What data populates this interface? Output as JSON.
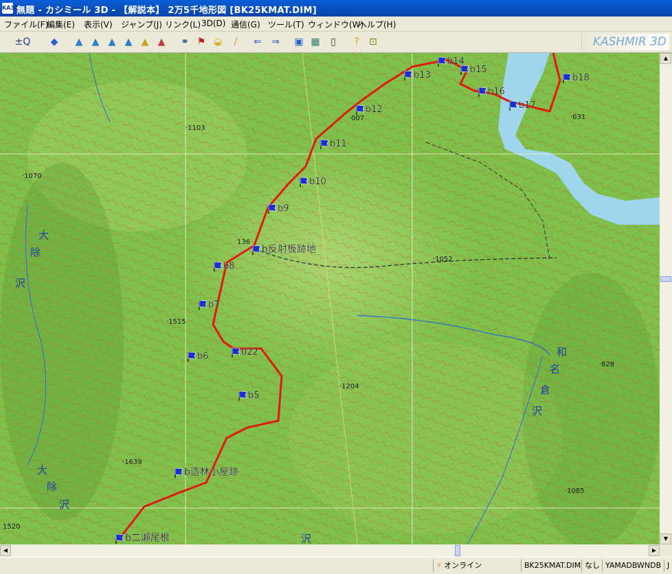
{
  "window": {
    "title": "無題 - カシミール 3D - 【解説本】 2万5千地形図 [BK25KMAT.DIM]",
    "app_icon_text": "KA3D"
  },
  "menu": [
    "ファイル(F)",
    "編集(E)",
    "表示(V)",
    "ジャンプ(J)",
    "リンク(L)",
    "3D(D)",
    "通信(G)",
    "ツール(T)",
    "ウィンドウ(W)",
    "ヘルプ(H)"
  ],
  "toolbar": {
    "brand": "KASHMIR 3D",
    "buttons": [
      {
        "name": "zoom-in-out",
        "glyph": "±Q"
      },
      {
        "name": "layer",
        "glyph": "◆"
      },
      {
        "name": "terrain-1",
        "glyph": "▲"
      },
      {
        "name": "terrain-2",
        "glyph": "▲"
      },
      {
        "name": "terrain-3",
        "glyph": "▲"
      },
      {
        "name": "terrain-4",
        "glyph": "▲"
      },
      {
        "name": "terrain-5",
        "glyph": "▲"
      },
      {
        "name": "terrain-6",
        "glyph": "▲"
      },
      {
        "name": "binoculars",
        "glyph": "⚭"
      },
      {
        "name": "flag-marker",
        "glyph": "⚑"
      },
      {
        "name": "cheese",
        "glyph": "◒"
      },
      {
        "name": "ruler",
        "glyph": "/"
      },
      {
        "name": "arrow-left",
        "glyph": "⇐"
      },
      {
        "name": "arrow-right",
        "glyph": "⇒"
      },
      {
        "name": "camera",
        "glyph": "▣"
      },
      {
        "name": "calculator",
        "glyph": "▦"
      },
      {
        "name": "gps-device",
        "glyph": "▯"
      },
      {
        "name": "help",
        "glyph": "?"
      },
      {
        "name": "exit",
        "glyph": "⊡"
      }
    ]
  },
  "map": {
    "colors": {
      "terrain": "#7fbf4a",
      "contour": "#b5542a",
      "track": "#e01a10",
      "water": "#9fd6ee",
      "flag": "#1a2fd0",
      "grid": "#f4f4cc"
    },
    "waypoints": [
      {
        "label": "b14",
        "key": "b14"
      },
      {
        "label": "b15",
        "key": "b15"
      },
      {
        "label": "b13",
        "key": "b13"
      },
      {
        "label": "b16",
        "key": "b16"
      },
      {
        "label": "b17",
        "key": "b17"
      },
      {
        "label": "b18",
        "key": "b18"
      },
      {
        "label": "b12",
        "key": "b12"
      },
      {
        "label": "b11",
        "key": "b11"
      },
      {
        "label": "b10",
        "key": "b10"
      },
      {
        "label": "b9",
        "key": "b9"
      },
      {
        "label": "b反射板跡地",
        "key": "reflector"
      },
      {
        "label": "b8",
        "key": "b8"
      },
      {
        "label": "b7",
        "key": "b7"
      },
      {
        "label": "b6",
        "key": "b6"
      },
      {
        "label": "022",
        "key": "w022"
      },
      {
        "label": "b5",
        "key": "b5"
      },
      {
        "label": "b造林小屋跡",
        "key": "hut"
      },
      {
        "label": "b二瀬尾根",
        "key": "ridge"
      }
    ],
    "elevations": [
      {
        "label": "·1103",
        "key": "e1103"
      },
      {
        "label": "·1070",
        "key": "e1070"
      },
      {
        "label": "·007",
        "key": "e007"
      },
      {
        "label": "·631",
        "key": "e631"
      },
      {
        "label": "·1052",
        "key": "e1052"
      },
      {
        "label": "·1515",
        "key": "e1515"
      },
      {
        "label": "·1204",
        "key": "e1204"
      },
      {
        "label": "·828",
        "key": "e828"
      },
      {
        "label": "·1639",
        "key": "e1639"
      },
      {
        "label": "·1085",
        "key": "e1085"
      },
      {
        "label": "1520",
        "key": "e1520"
      },
      {
        "label": "136",
        "key": "e136"
      }
    ],
    "rivers": [
      {
        "label": "大",
        "key": "r1a"
      },
      {
        "label": "除",
        "key": "r1b"
      },
      {
        "label": "沢",
        "key": "r1c"
      },
      {
        "label": "大",
        "key": "r2a"
      },
      {
        "label": "除",
        "key": "r2b"
      },
      {
        "label": "沢",
        "key": "r2c"
      },
      {
        "label": "和",
        "key": "r3a"
      },
      {
        "label": "名",
        "key": "r3b"
      },
      {
        "label": "倉",
        "key": "r3c"
      },
      {
        "label": "沢",
        "key": "r3d"
      },
      {
        "label": "沢",
        "key": "r4"
      }
    ]
  },
  "status": {
    "online": "オンライン",
    "file": "BK25KMAT.DIM",
    "none": "なし",
    "db": "YAMADBWNDB",
    "extra": "J"
  }
}
